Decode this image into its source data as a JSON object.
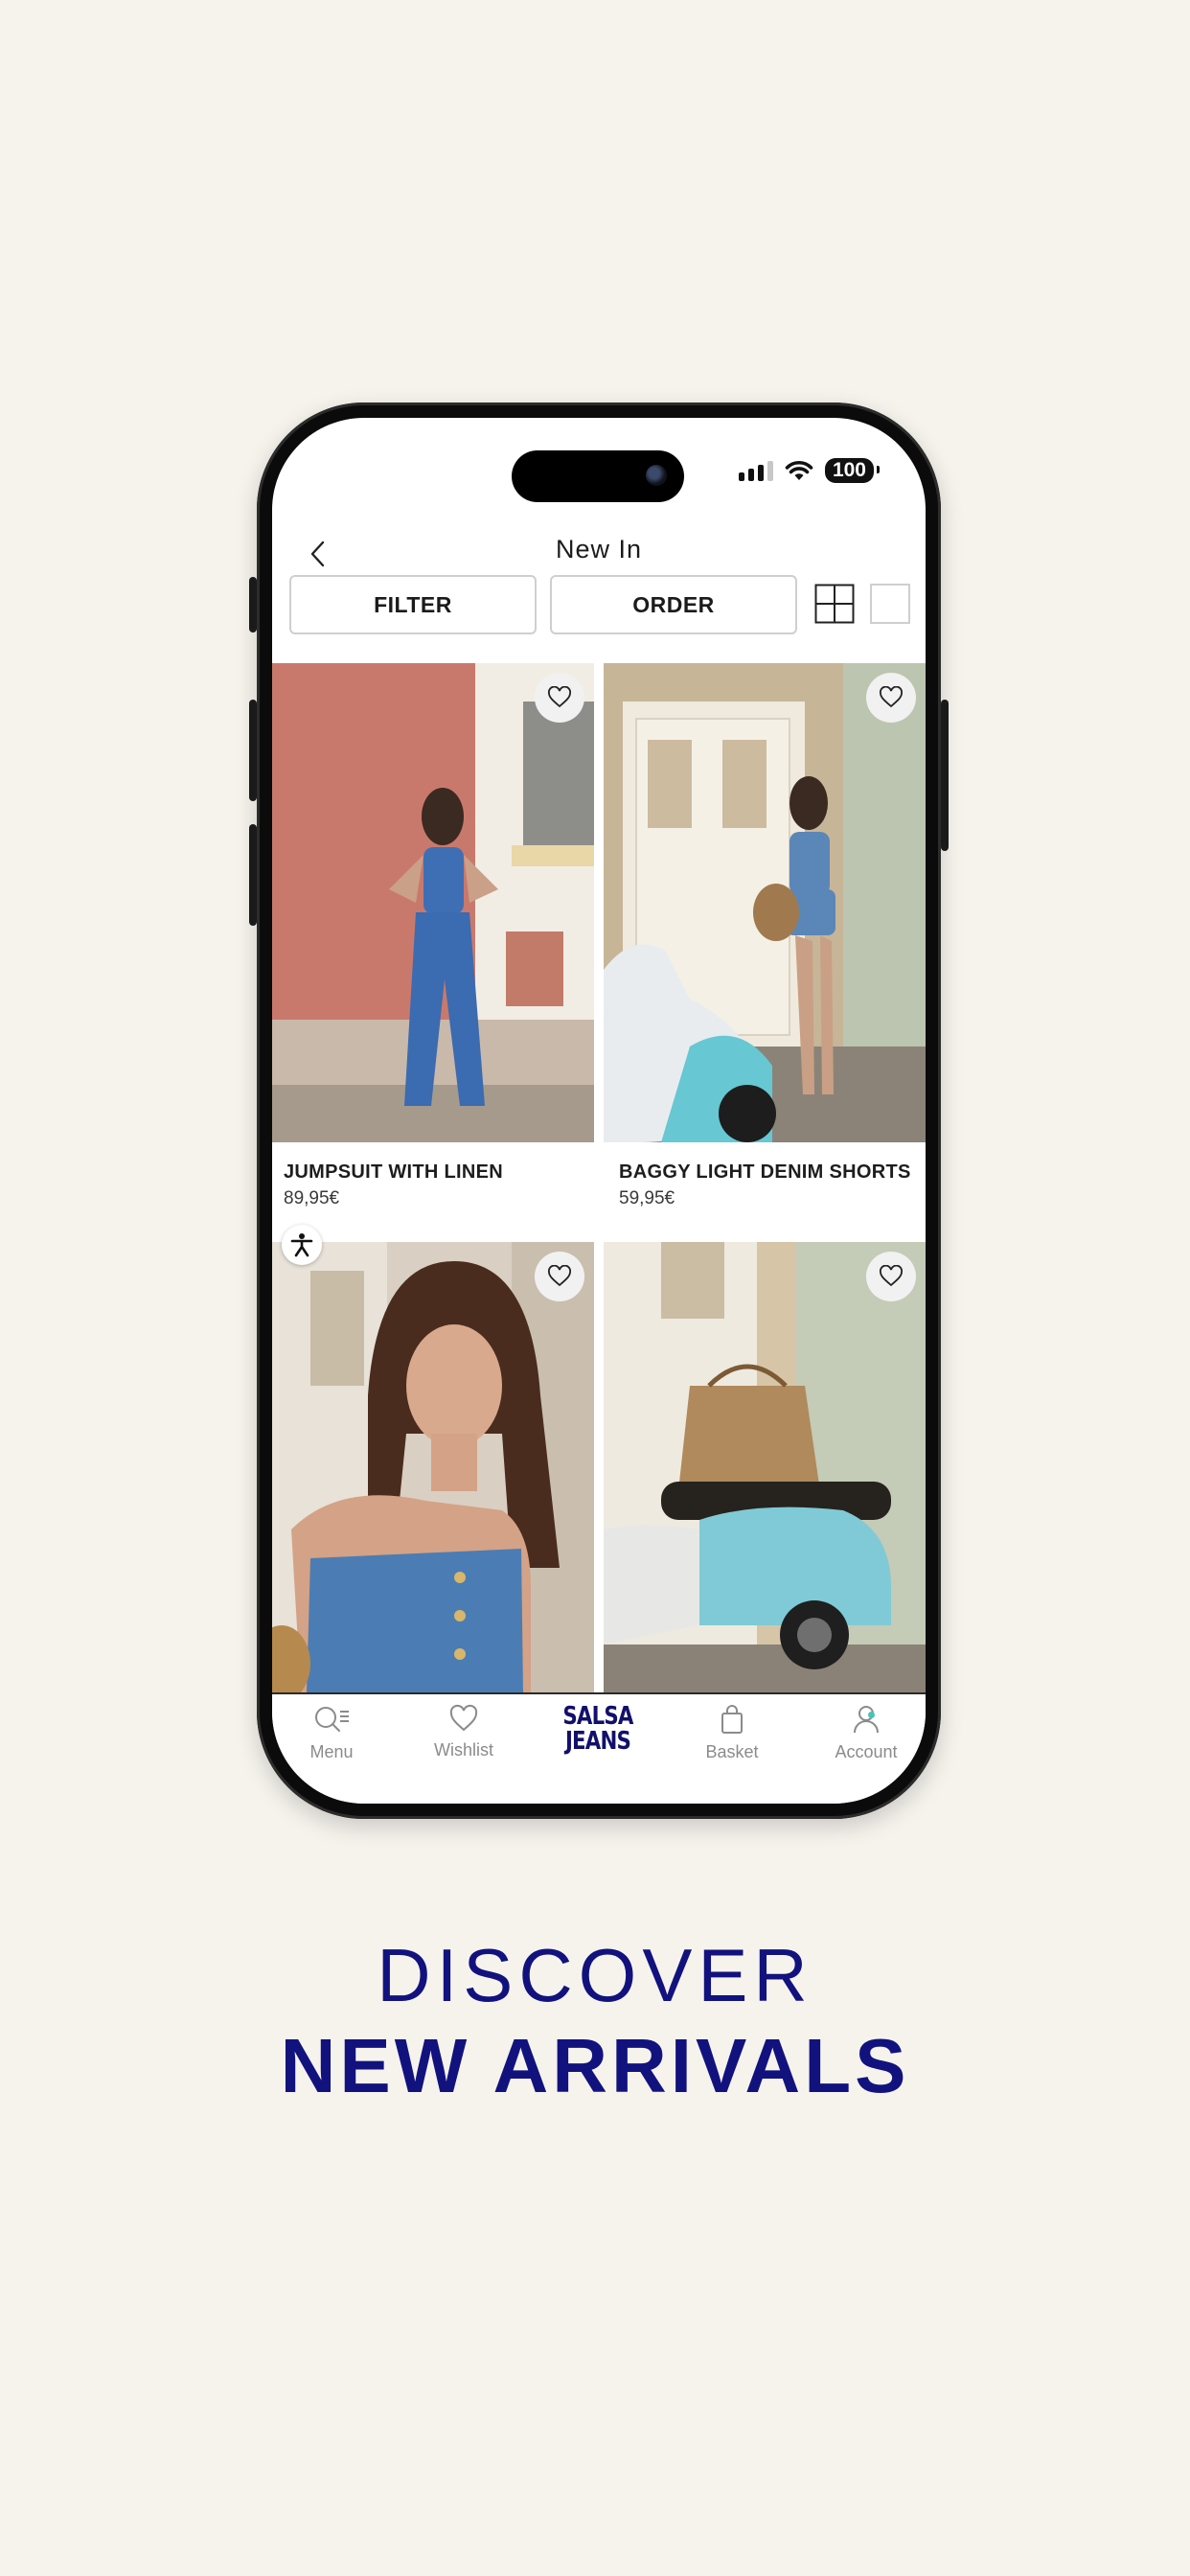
{
  "header": {
    "title": "New In"
  },
  "toolbar": {
    "filter_label": "FILTER",
    "order_label": "ORDER"
  },
  "status_bar": {
    "battery": "100"
  },
  "products": [
    {
      "name": "JUMPSUIT WITH LINEN",
      "price": "89,95€"
    },
    {
      "name": "BAGGY LIGHT DENIM SHORTS",
      "price": "59,95€"
    }
  ],
  "tabbar": {
    "menu": "Menu",
    "wishlist": "Wishlist",
    "logo_line1": "SALSA",
    "logo_line2": "JEANS",
    "basket": "Basket",
    "account": "Account"
  },
  "tagline": {
    "line1": "DISCOVER",
    "line2": "NEW ARRIVALS"
  },
  "icons": [
    "back-chevron-icon",
    "heart-icon",
    "grid-four-icon",
    "grid-single-icon",
    "search-menu-icon",
    "bag-icon",
    "user-icon",
    "accessibility-icon",
    "wifi-icon",
    "signal-icon"
  ],
  "colors": {
    "brand_navy": "#12127e",
    "background": "#f6f3ed",
    "notification_dot": "#49c3b8"
  }
}
